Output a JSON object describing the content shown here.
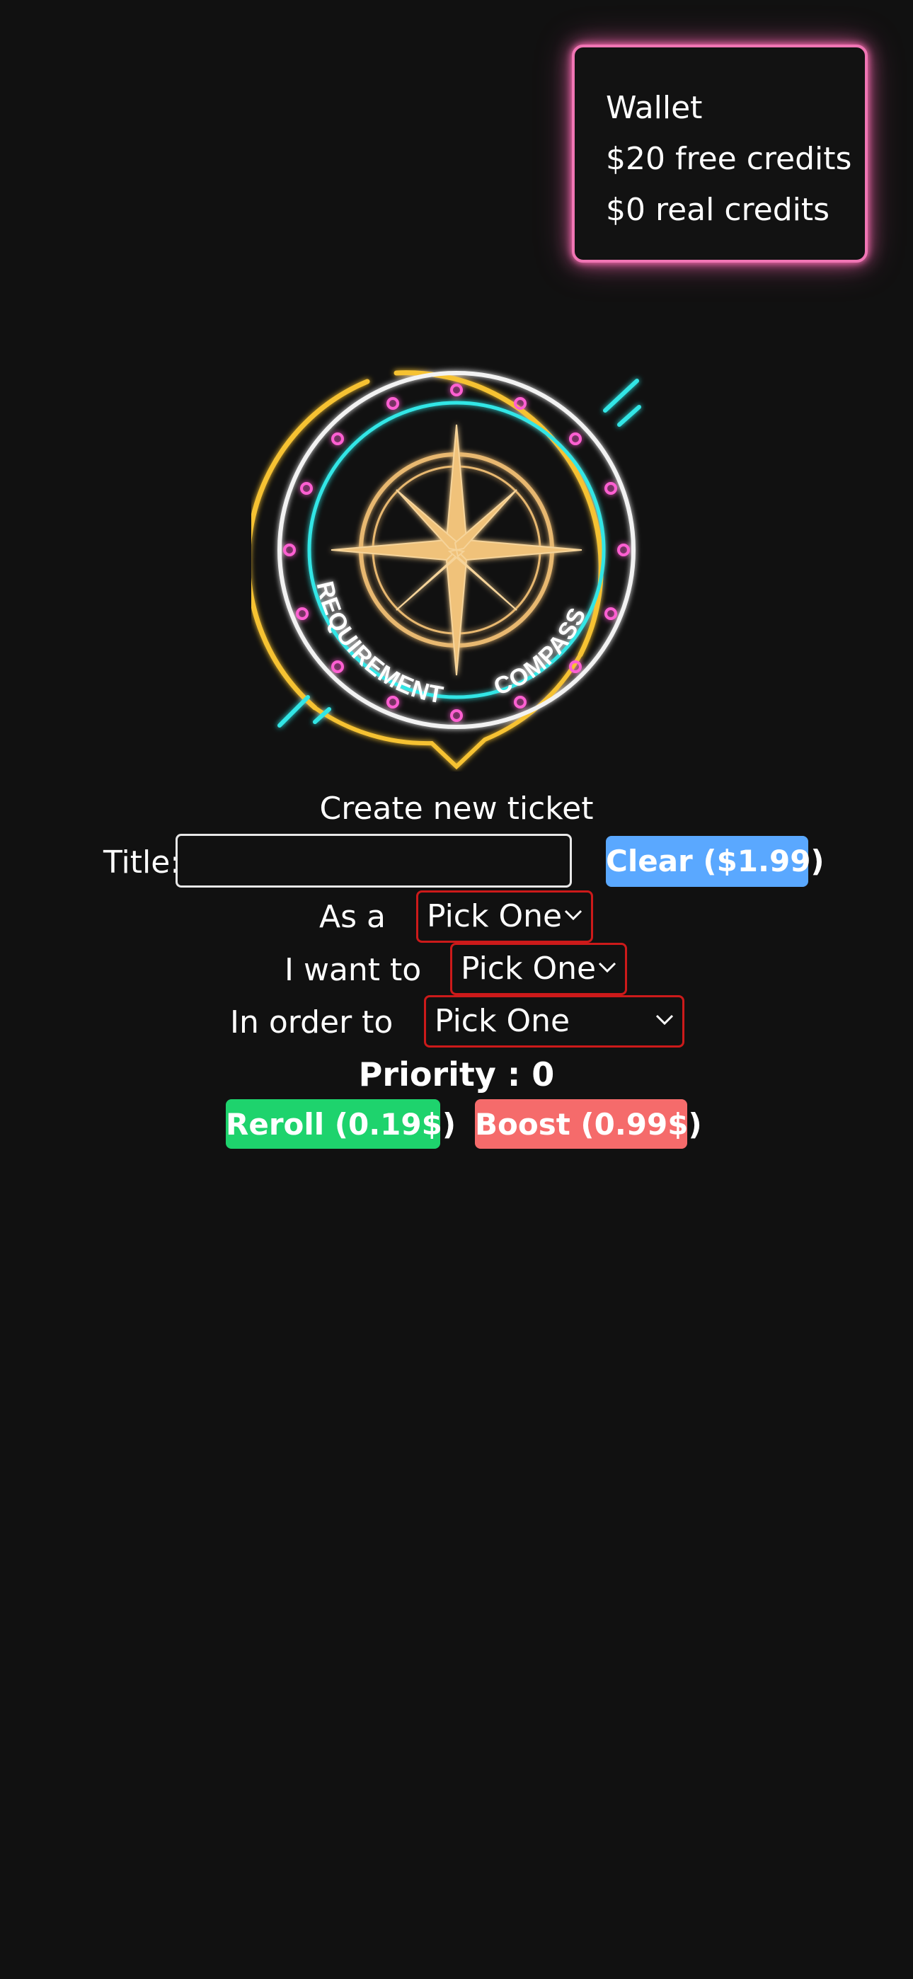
{
  "wallet": {
    "title": "Wallet",
    "free_credits": "$20 free credits",
    "real_credits": "$0 real credits",
    "border_color": "#f075b4"
  },
  "logo": {
    "text_left": "REQUIREMENT",
    "text_right": "COMPASS"
  },
  "form": {
    "heading": "Create new ticket",
    "title_label": "Title:",
    "title_value": "",
    "clear_label": "Clear ($1.99)",
    "as_a_label": "As a",
    "as_a_value": "Pick One",
    "want_label": "I want to",
    "want_value": "Pick One",
    "order_label": "In order to",
    "order_value": "Pick One",
    "priority_text": "Priority : 0",
    "reroll_label": "Reroll (0.19$)",
    "boost_label": "Boost (0.99$)"
  },
  "colors": {
    "background": "#111111",
    "clear_button": "#5aa8ff",
    "reroll_button": "#1ed36d",
    "boost_button": "#f56b6b",
    "select_border": "#cc1a1a"
  },
  "icons": {
    "logo": "compass-logo-icon",
    "dropdown": "chevron-down-icon"
  }
}
